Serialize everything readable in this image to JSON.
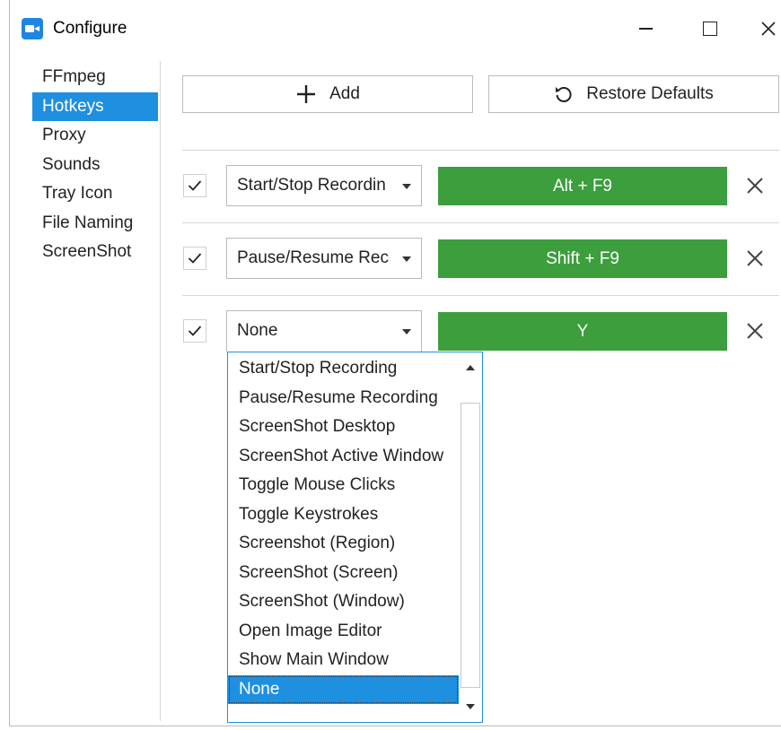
{
  "window": {
    "title": "Configure",
    "app_icon": "video-camera-icon"
  },
  "sidebar": {
    "items": [
      {
        "label": "FFmpeg",
        "active": false
      },
      {
        "label": "Hotkeys",
        "active": true
      },
      {
        "label": "Proxy",
        "active": false
      },
      {
        "label": "Sounds",
        "active": false
      },
      {
        "label": "Tray Icon",
        "active": false
      },
      {
        "label": "File Naming",
        "active": false
      },
      {
        "label": "ScreenShot",
        "active": false
      }
    ]
  },
  "toolbar": {
    "add_label": "Add",
    "restore_label": "Restore Defaults"
  },
  "hotkeys": [
    {
      "enabled": true,
      "action": "Start/Stop Recordin",
      "key": "Alt + F9"
    },
    {
      "enabled": true,
      "action": "Pause/Resume Recc",
      "key": "Shift + F9"
    },
    {
      "enabled": true,
      "action": "None",
      "key": "Y"
    }
  ],
  "dropdown": {
    "options": [
      "Start/Stop Recording",
      "Pause/Resume Recording",
      "ScreenShot Desktop",
      "ScreenShot Active Window",
      "Toggle Mouse Clicks",
      "Toggle Keystrokes",
      "Screenshot (Region)",
      "ScreenShot (Screen)",
      "ScreenShot (Window)",
      "Open Image Editor",
      "Show Main Window",
      "None"
    ],
    "selected": "None"
  },
  "colors": {
    "accent": "#1f8fe0",
    "hotkey_green": "#3c9e3c"
  }
}
